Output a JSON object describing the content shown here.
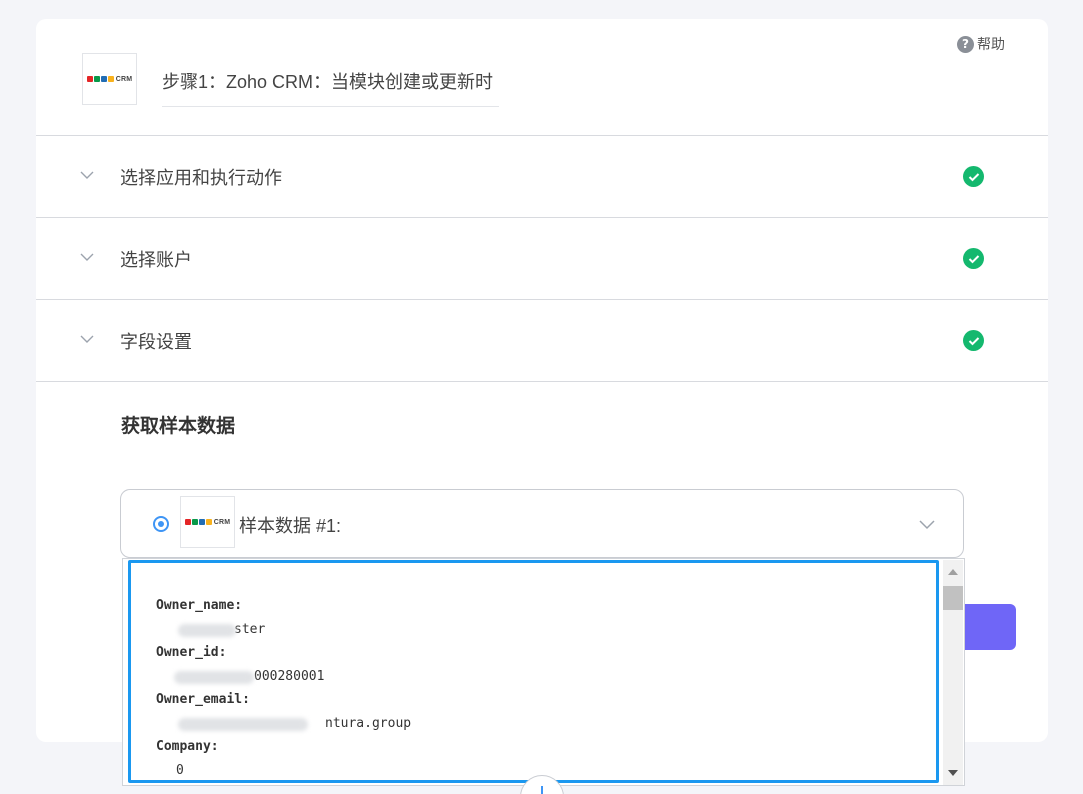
{
  "header": {
    "help_label": "帮助",
    "help_icon": "question-circle-icon",
    "step_title": "步骤1：Zoho CRM：当模块创建或更新时",
    "app_logo_text": "CRM",
    "brand_colors": [
      "#e42527",
      "#089949",
      "#226db4",
      "#f9b21d"
    ]
  },
  "sections": [
    {
      "label": "选择应用和执行动作",
      "status": "complete"
    },
    {
      "label": "选择账户",
      "status": "complete"
    },
    {
      "label": "字段设置",
      "status": "complete"
    }
  ],
  "sample": {
    "heading": "获取样本数据",
    "selected_label": "样本数据 #1:",
    "logo_text": "CRM"
  },
  "sample_fields": [
    {
      "key": "Owner_name:",
      "value": "ster"
    },
    {
      "key": "Owner_id:",
      "value": "000280001"
    },
    {
      "key": "Owner_email:",
      "value": "ntura.group"
    },
    {
      "key": "Company:",
      "value": "0"
    }
  ],
  "colors": {
    "accent_blue": "#1a98f0",
    "success_green": "#14b86e",
    "button_purple": "#6f66f7"
  }
}
